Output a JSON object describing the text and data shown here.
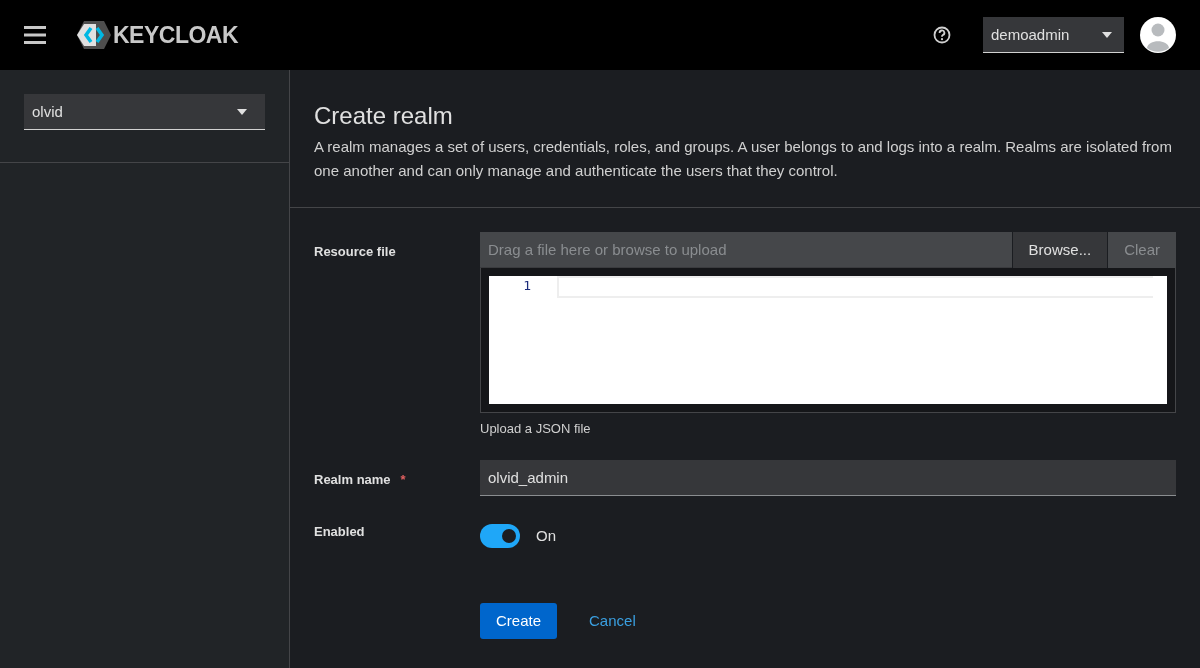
{
  "header": {
    "logo_text": "KEYCLOAK",
    "user_menu": "demoadmin"
  },
  "sidebar": {
    "realm_selector": "olvid"
  },
  "page": {
    "title": "Create realm",
    "description": "A realm manages a set of users, credentials, roles, and groups. A user belongs to and logs into a realm. Realms are isolated from one another and can only manage and authenticate the users that they control."
  },
  "form": {
    "resource_file": {
      "label": "Resource file",
      "placeholder": "Drag a file here or browse to upload",
      "browse_button": "Browse...",
      "clear_button": {
        "label": "Clear",
        "disabled": true
      },
      "editor": {
        "line_numbers": [
          "1"
        ]
      },
      "helper_text": "Upload a JSON file"
    },
    "realm_name": {
      "label": "Realm name",
      "required_mark": "*",
      "value": "olvid_admin"
    },
    "enabled": {
      "label": "Enabled",
      "on": true,
      "state_text": "On"
    }
  },
  "actions": {
    "create_button": "Create",
    "cancel_link": "Cancel"
  }
}
